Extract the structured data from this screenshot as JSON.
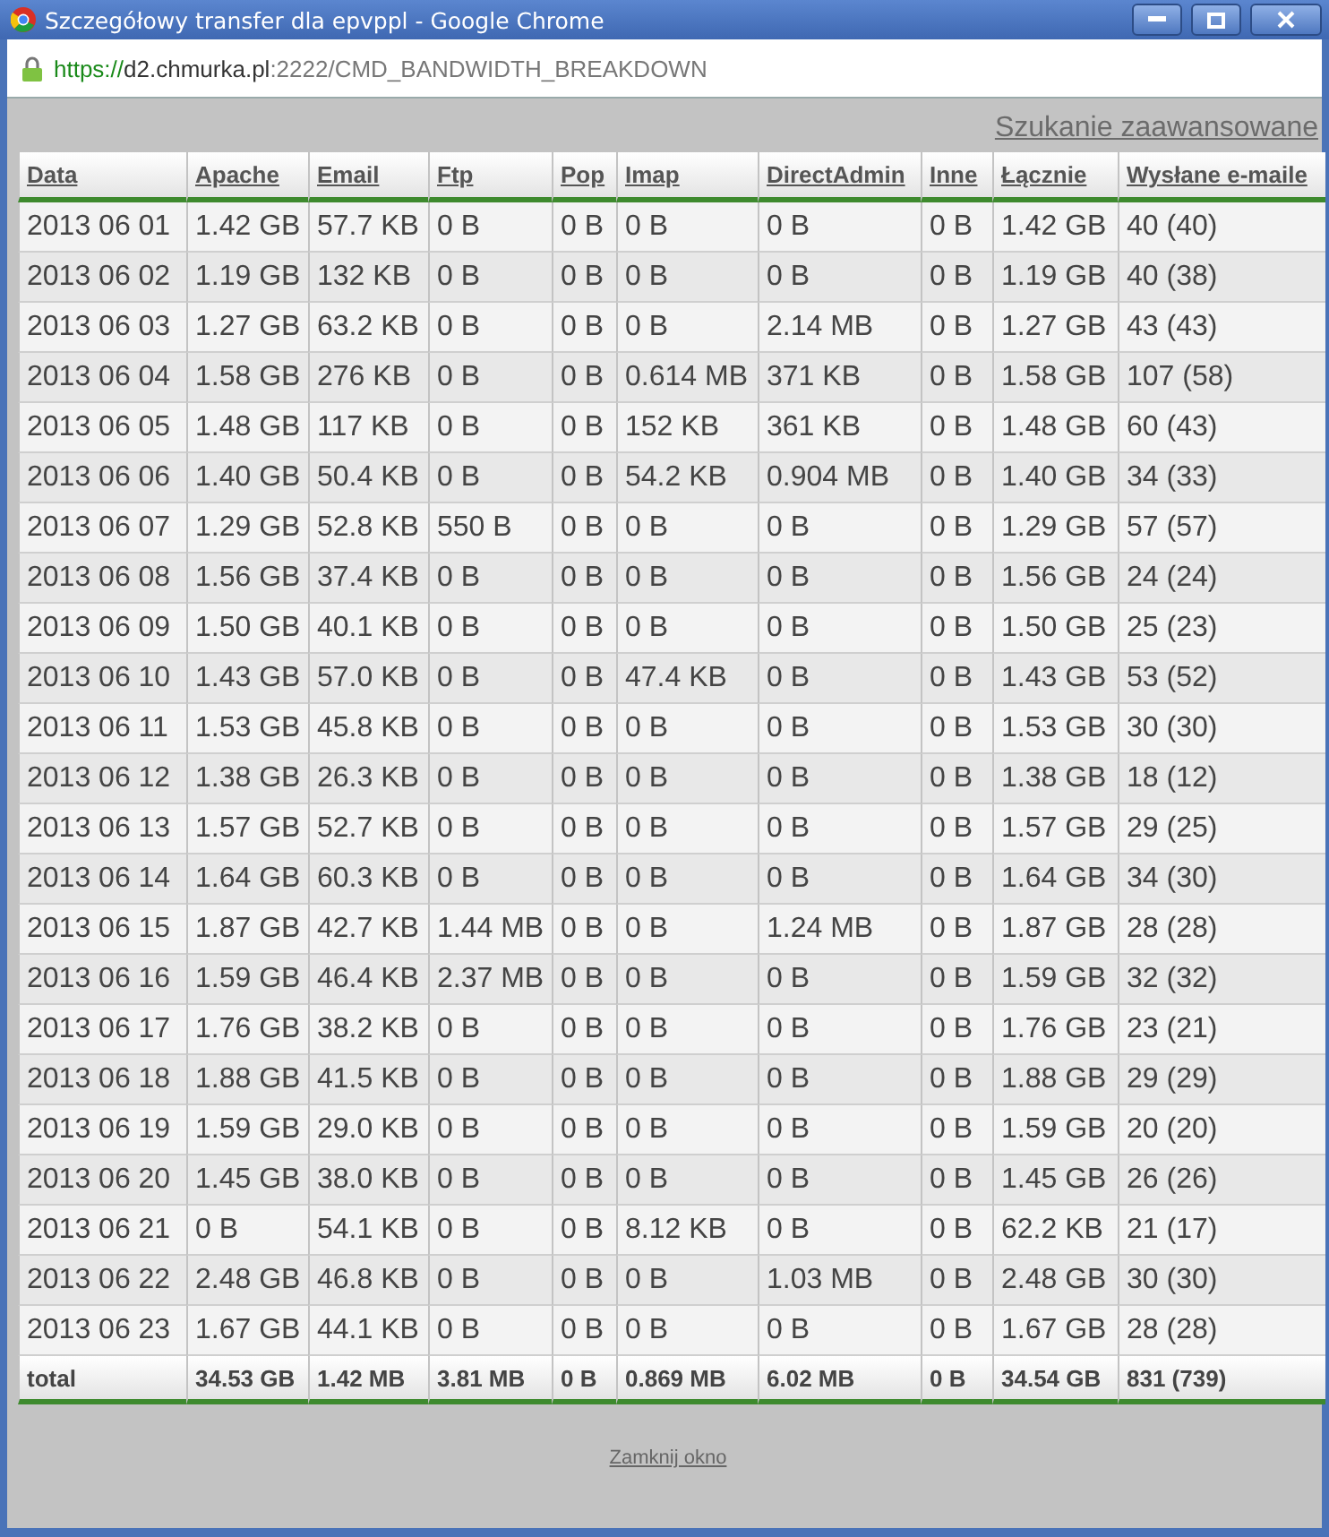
{
  "window": {
    "title": "Szczegółowy transfer dla epvppl - Google Chrome"
  },
  "address_bar": {
    "scheme": "https://",
    "host": "d2.chmurka.pl",
    "rest": ":2222/CMD_BANDWIDTH_BREAKDOWN"
  },
  "advanced_search_link": "Szukanie zaawansowane",
  "table": {
    "columns": [
      "Data",
      "Apache",
      "Email",
      "Ftp",
      "Pop",
      "Imap",
      "DirectAdmin",
      "Inne",
      "Łącznie",
      "Wysłane e-maile"
    ],
    "rows": [
      [
        "2013 06 01",
        "1.42 GB",
        "57.7 KB",
        "0 B",
        "0 B",
        "0 B",
        "0 B",
        "0 B",
        "1.42 GB",
        "40 (40)"
      ],
      [
        "2013 06 02",
        "1.19 GB",
        "132 KB",
        "0 B",
        "0 B",
        "0 B",
        "0 B",
        "0 B",
        "1.19 GB",
        "40 (38)"
      ],
      [
        "2013 06 03",
        "1.27 GB",
        "63.2 KB",
        "0 B",
        "0 B",
        "0 B",
        "2.14 MB",
        "0 B",
        "1.27 GB",
        "43 (43)"
      ],
      [
        "2013 06 04",
        "1.58 GB",
        "276 KB",
        "0 B",
        "0 B",
        "0.614 MB",
        "371 KB",
        "0 B",
        "1.58 GB",
        "107 (58)"
      ],
      [
        "2013 06 05",
        "1.48 GB",
        "117 KB",
        "0 B",
        "0 B",
        "152 KB",
        "361 KB",
        "0 B",
        "1.48 GB",
        "60 (43)"
      ],
      [
        "2013 06 06",
        "1.40 GB",
        "50.4 KB",
        "0 B",
        "0 B",
        "54.2 KB",
        "0.904 MB",
        "0 B",
        "1.40 GB",
        "34 (33)"
      ],
      [
        "2013 06 07",
        "1.29 GB",
        "52.8 KB",
        "550 B",
        "0 B",
        "0 B",
        "0 B",
        "0 B",
        "1.29 GB",
        "57 (57)"
      ],
      [
        "2013 06 08",
        "1.56 GB",
        "37.4 KB",
        "0 B",
        "0 B",
        "0 B",
        "0 B",
        "0 B",
        "1.56 GB",
        "24 (24)"
      ],
      [
        "2013 06 09",
        "1.50 GB",
        "40.1 KB",
        "0 B",
        "0 B",
        "0 B",
        "0 B",
        "0 B",
        "1.50 GB",
        "25 (23)"
      ],
      [
        "2013 06 10",
        "1.43 GB",
        "57.0 KB",
        "0 B",
        "0 B",
        "47.4 KB",
        "0 B",
        "0 B",
        "1.43 GB",
        "53 (52)"
      ],
      [
        "2013 06 11",
        "1.53 GB",
        "45.8 KB",
        "0 B",
        "0 B",
        "0 B",
        "0 B",
        "0 B",
        "1.53 GB",
        "30 (30)"
      ],
      [
        "2013 06 12",
        "1.38 GB",
        "26.3 KB",
        "0 B",
        "0 B",
        "0 B",
        "0 B",
        "0 B",
        "1.38 GB",
        "18 (12)"
      ],
      [
        "2013 06 13",
        "1.57 GB",
        "52.7 KB",
        "0 B",
        "0 B",
        "0 B",
        "0 B",
        "0 B",
        "1.57 GB",
        "29 (25)"
      ],
      [
        "2013 06 14",
        "1.64 GB",
        "60.3 KB",
        "0 B",
        "0 B",
        "0 B",
        "0 B",
        "0 B",
        "1.64 GB",
        "34 (30)"
      ],
      [
        "2013 06 15",
        "1.87 GB",
        "42.7 KB",
        "1.44 MB",
        "0 B",
        "0 B",
        "1.24 MB",
        "0 B",
        "1.87 GB",
        "28 (28)"
      ],
      [
        "2013 06 16",
        "1.59 GB",
        "46.4 KB",
        "2.37 MB",
        "0 B",
        "0 B",
        "0 B",
        "0 B",
        "1.59 GB",
        "32 (32)"
      ],
      [
        "2013 06 17",
        "1.76 GB",
        "38.2 KB",
        "0 B",
        "0 B",
        "0 B",
        "0 B",
        "0 B",
        "1.76 GB",
        "23 (21)"
      ],
      [
        "2013 06 18",
        "1.88 GB",
        "41.5 KB",
        "0 B",
        "0 B",
        "0 B",
        "0 B",
        "0 B",
        "1.88 GB",
        "29 (29)"
      ],
      [
        "2013 06 19",
        "1.59 GB",
        "29.0 KB",
        "0 B",
        "0 B",
        "0 B",
        "0 B",
        "0 B",
        "1.59 GB",
        "20 (20)"
      ],
      [
        "2013 06 20",
        "1.45 GB",
        "38.0 KB",
        "0 B",
        "0 B",
        "0 B",
        "0 B",
        "0 B",
        "1.45 GB",
        "26 (26)"
      ],
      [
        "2013 06 21",
        "0 B",
        "54.1 KB",
        "0 B",
        "0 B",
        "8.12 KB",
        "0 B",
        "0 B",
        "62.2 KB",
        "21 (17)"
      ],
      [
        "2013 06 22",
        "2.48 GB",
        "46.8 KB",
        "0 B",
        "0 B",
        "0 B",
        "1.03 MB",
        "0 B",
        "2.48 GB",
        "30 (30)"
      ],
      [
        "2013 06 23",
        "1.67 GB",
        "44.1 KB",
        "0 B",
        "0 B",
        "0 B",
        "0 B",
        "0 B",
        "1.67 GB",
        "28 (28)"
      ]
    ],
    "total": [
      "total",
      "34.53 GB",
      "1.42 MB",
      "3.81 MB",
      "0 B",
      "0.869 MB",
      "6.02 MB",
      "0 B",
      "34.54 GB",
      "831 (739)"
    ]
  },
  "close_link": "Zamknij okno"
}
